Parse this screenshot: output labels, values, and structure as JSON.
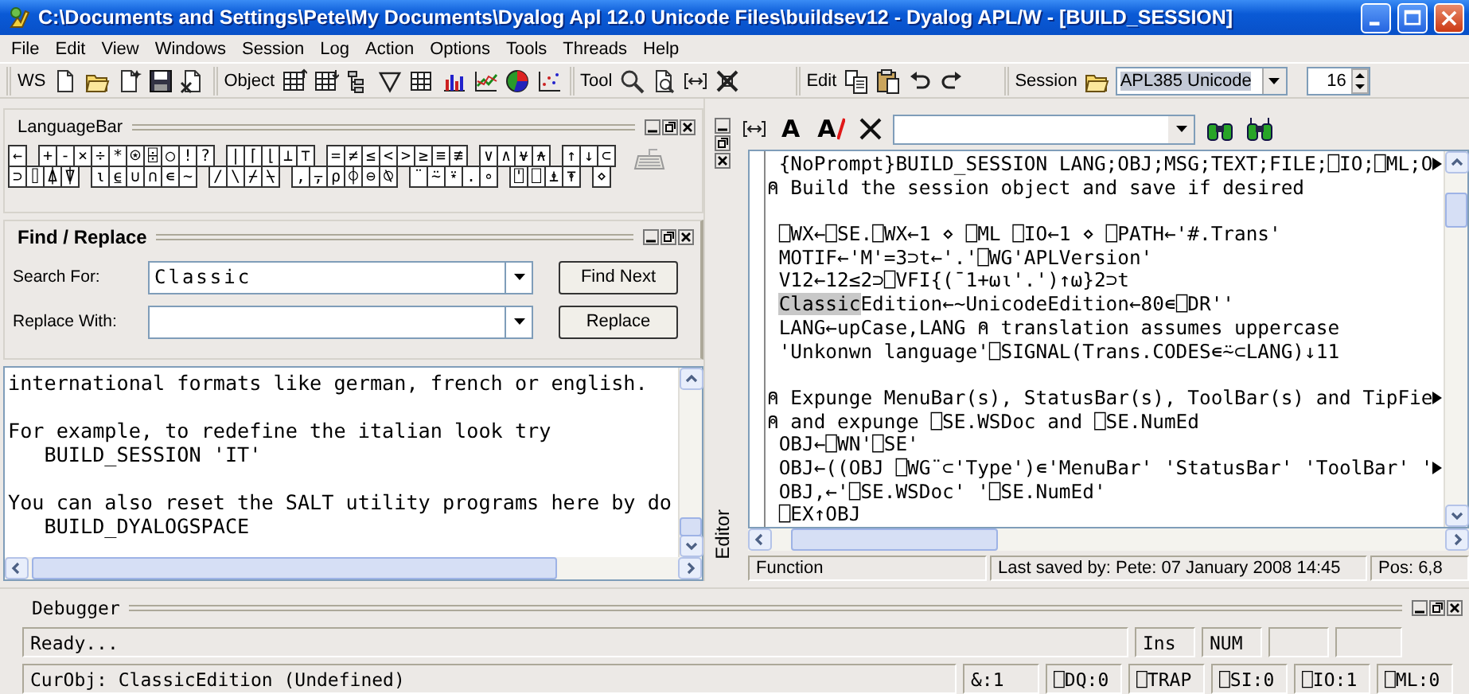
{
  "window": {
    "title": "C:\\Documents and Settings\\Pete\\My Documents\\Dyalog Apl 12.0 Unicode Files\\buildsev12 - Dyalog APL/W - [BUILD_SESSION]"
  },
  "menu": [
    {
      "label": "File"
    },
    {
      "label": "Edit"
    },
    {
      "label": "View"
    },
    {
      "label": "Windows"
    },
    {
      "label": "Session"
    },
    {
      "label": "Log"
    },
    {
      "label": "Action"
    },
    {
      "label": "Options"
    },
    {
      "label": "Tools"
    },
    {
      "label": "Threads"
    },
    {
      "label": "Help"
    }
  ],
  "toolbar": {
    "groups": [
      {
        "label": "WS"
      },
      {
        "label": "Object"
      },
      {
        "label": "Tool"
      },
      {
        "label": "Edit"
      },
      {
        "label": "Session"
      }
    ],
    "font_combo": {
      "value": "APL385 Unicode",
      "text_selected": true
    },
    "font_size": "16"
  },
  "language_bar": {
    "title": "LanguageBar",
    "rows": [
      [
        [
          "←"
        ],
        [
          "+",
          "-",
          "×",
          "÷",
          "*",
          "⍟",
          "⌹",
          "○",
          "!",
          "?"
        ],
        [
          "|",
          "⌈",
          "⌊",
          "⊥",
          "⊤"
        ],
        [
          "=",
          "≠",
          "≤",
          "<",
          ">",
          "≥",
          "≡",
          "≢"
        ],
        [
          "∨",
          "∧",
          "⍱",
          "⍲"
        ],
        [
          "↑",
          "↓",
          "⊂"
        ]
      ],
      [
        [
          "⊃",
          "⌷",
          "⍋",
          "⍒"
        ],
        [
          "⍳",
          "⍷",
          "∪",
          "∩",
          "∊",
          "~"
        ],
        [
          "/",
          "\\",
          "⌿",
          "⍀"
        ],
        [
          ",",
          "⍪",
          "⍴",
          "⌽",
          "⊖",
          "⍉"
        ],
        [
          "¨",
          "⍨",
          "⍣",
          ".",
          "∘"
        ],
        [
          "⍞",
          "⎕",
          "⍎",
          "⍕"
        ],
        [
          "⋄"
        ]
      ]
    ]
  },
  "find_replace": {
    "title": "Find / Replace",
    "search": {
      "label": "Search For:",
      "value": "Classic"
    },
    "replace": {
      "label": "Replace With:"
    },
    "buttons": [
      {
        "label": "Find Next"
      },
      {
        "label": "Replace"
      }
    ]
  },
  "session": {
    "lines": [
      {
        "text": "international formats like german, french or english."
      },
      {
        "text": "For example, to redefine the italian look try",
        "gap_before": true
      },
      {
        "text": "BUILD_SESSION 'IT'",
        "indent": true
      },
      {
        "text": "You can also reset the SALT utility programs here by do",
        "gap_before": true
      },
      {
        "text": "BUILD_DYALOGSPACE",
        "indent": true
      }
    ]
  },
  "editor": {
    "side_label": "Editor",
    "tools": [
      {
        "glyph": "A",
        "kind": "plain"
      },
      {
        "glyph": "A",
        "kind": "struck"
      }
    ],
    "lines": [
      {
        "text": "{NoPrompt}BUILD_SESSION LANG;OBJ;MSG;TEXT;FILE;⎕IO;⎕ML;O",
        "indent": true,
        "clipped": true
      },
      {
        "text": "⍝ Build the session object and save if desired"
      },
      {
        "text": "⎕WX←⎕SE.⎕WX←1 ⋄ ⎕ML ⎕IO←1 ⋄ ⎕PATH←'#.Trans'",
        "indent": true,
        "gap_before": true
      },
      {
        "text": "MOTIF←'M'=3⊃t←'.'⎕WG'APLVersion'",
        "indent": true
      },
      {
        "text": "V12←12≤2⊃⎕VFI{(¯1+⍵⍳'.')↑⍵}2⊃t",
        "indent": true
      },
      {
        "highlight": "Classic",
        "text": "Edition←~UnicodeEdition←80∊⎕DR''",
        "indent": true
      },
      {
        "text": "LANG←upCase,LANG ⍝ translation assumes uppercase",
        "indent": true
      },
      {
        "text": "'Unkonwn language'⎕SIGNAL(Trans.CODES∊⍨⊂LANG)↓11",
        "indent": true
      },
      {
        "text": "⍝ Expunge MenuBar(s), StatusBar(s), ToolBar(s) and TipFie",
        "gap_before": true,
        "clipped": true
      },
      {
        "text": "⍝ and expunge ⎕SE.WSDoc and ⎕SE.NumEd"
      },
      {
        "text": "OBJ←⎕WN'⎕SE'",
        "indent": true
      },
      {
        "text": "OBJ←((OBJ ⎕WG¨⊂'Type')∊'MenuBar' 'StatusBar' 'ToolBar' '",
        "indent": true,
        "clipped": true
      },
      {
        "text": "OBJ,←'⎕SE.WSDoc' '⎕SE.NumEd'",
        "indent": true
      },
      {
        "text": "⎕EX↑OBJ",
        "indent": true
      }
    ],
    "status": [
      "Function",
      "Last saved by: Pete: 07 January 2008 14:45",
      "Pos: 6,8"
    ]
  },
  "debugger": {
    "title": "Debugger",
    "message": "Ready...",
    "indicators": [
      "Ins",
      "NUM"
    ],
    "info": [
      "CurObj: ClassicEdition (Undefined)",
      "&:1",
      "⎕DQ:0",
      "⎕TRAP",
      "⎕SI:0",
      "⎕IO:1",
      "⎕ML:0"
    ]
  }
}
